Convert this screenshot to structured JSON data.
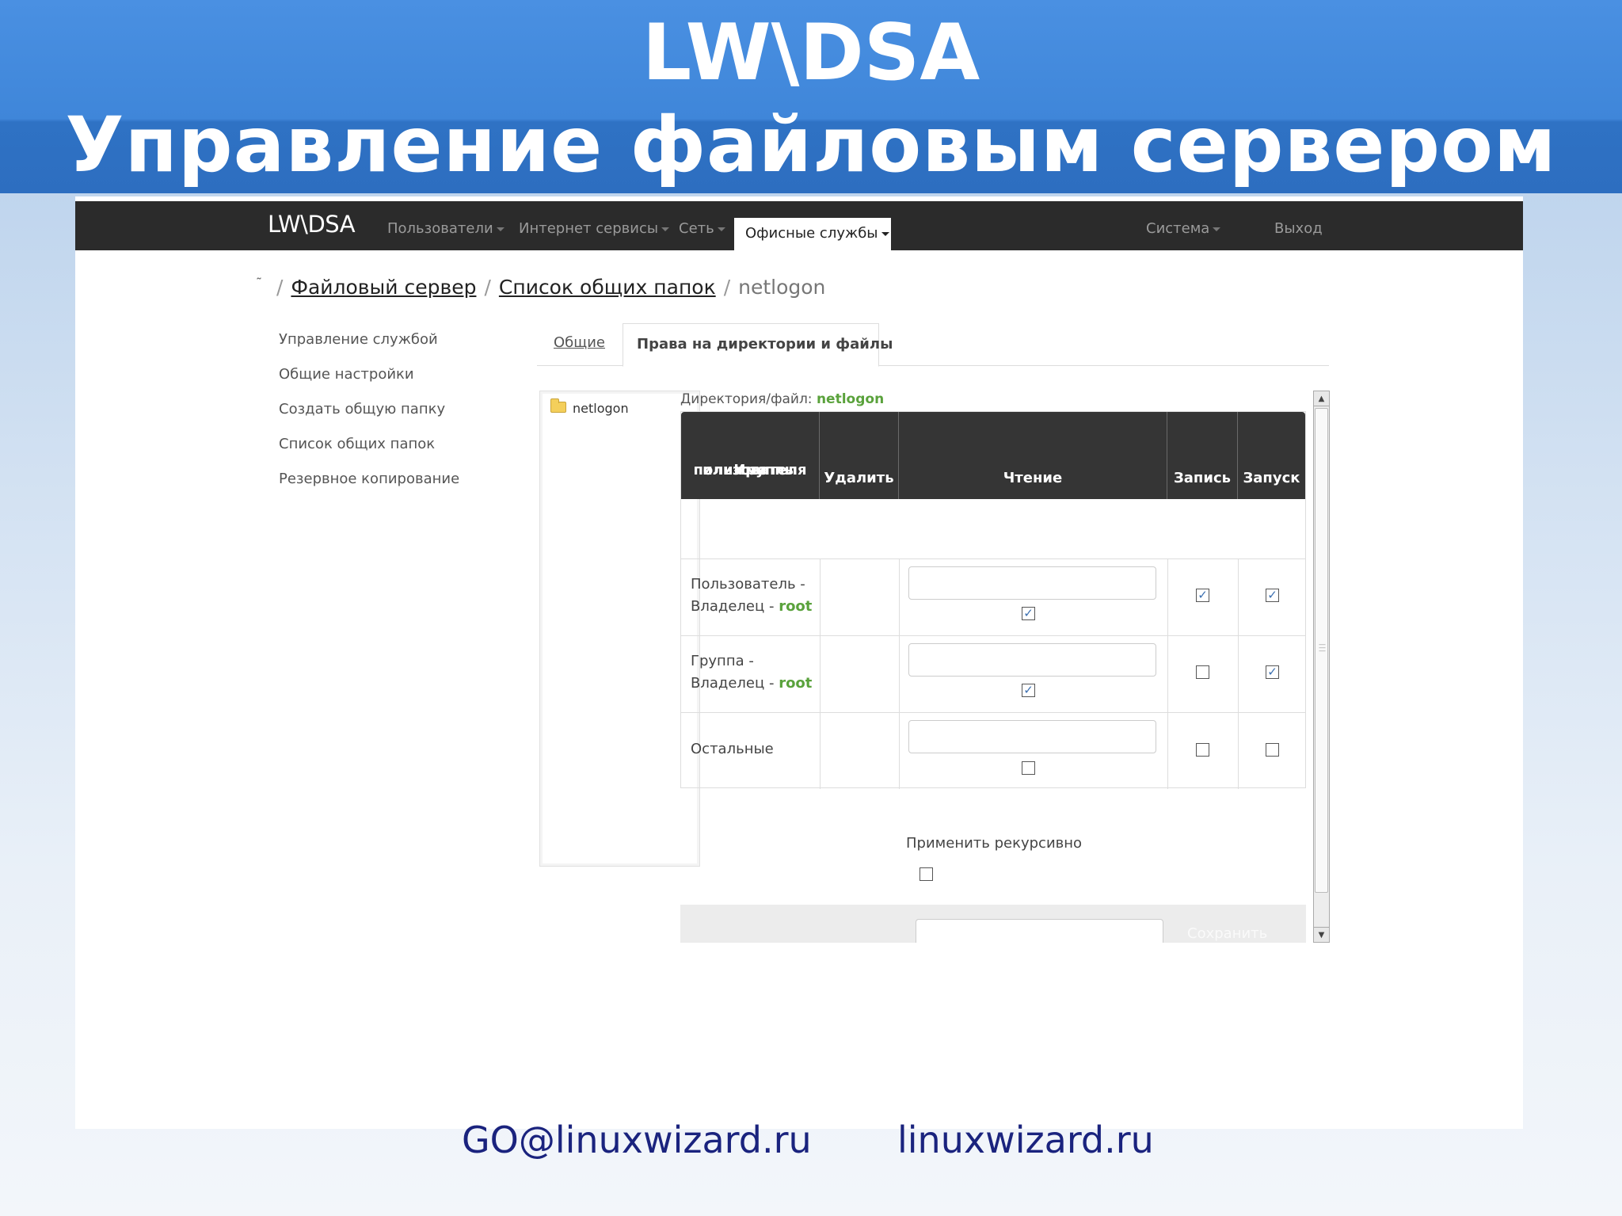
{
  "slide": {
    "title_line1": "LW\\DSA",
    "title_line2": "Управление файловым сервером",
    "contact_email": "GO@linuxwizard.ru",
    "contact_site": "linuxwizard.ru"
  },
  "navbar": {
    "brand": "LW\\DSA",
    "items": [
      "Пользователи",
      "Интернет сервисы",
      "Сеть",
      "Офисные службы",
      "Система",
      "Выход"
    ],
    "active_item": "Офисные службы"
  },
  "breadcrumb": {
    "home": "˜",
    "items": [
      "Файловый сервер",
      "Список общих папок",
      "netlogon"
    ]
  },
  "sidebar": {
    "items": [
      "Управление службой",
      "Общие настройки",
      "Создать общую папку",
      "Список общих папок",
      "Резервное копирование"
    ]
  },
  "tabs": {
    "general": "Общие",
    "permissions": "Права на директории и файлы"
  },
  "tree": {
    "folder": "netlogon"
  },
  "directory": {
    "label": "Директория/файл:",
    "value": "netlogon"
  },
  "table": {
    "headers": {
      "name_line1": "Имя",
      "name_line2": "пользователя",
      "name_line3": "или группы",
      "delete": "Удалить",
      "read": "Чтение",
      "write": "Запись",
      "exec": "Запуск"
    },
    "rows": [
      {
        "line1": "Пользователь -",
        "line2": "Владелец - ",
        "owner": "root",
        "read": true,
        "write": true,
        "exec": true
      },
      {
        "line1": "Группа -",
        "line2": "Владелец - ",
        "owner": "root",
        "read": true,
        "write": false,
        "exec": true
      },
      {
        "line1": "Остальные",
        "read": false,
        "write": false,
        "exec": false
      }
    ]
  },
  "recursive": {
    "label": "Применить рекурсивно",
    "checked": false
  },
  "footer": {
    "save": "Сохранить"
  },
  "icons": {
    "folder": "folder-icon",
    "scroll_up": "arrow-up-icon",
    "scroll_down": "arrow-down-icon",
    "check": "checkmark"
  },
  "colors": {
    "header_blue": "#3f86d9",
    "navbar": "#2b2b2b",
    "accent_green": "#5aa23c",
    "contact": "#1a237e"
  }
}
